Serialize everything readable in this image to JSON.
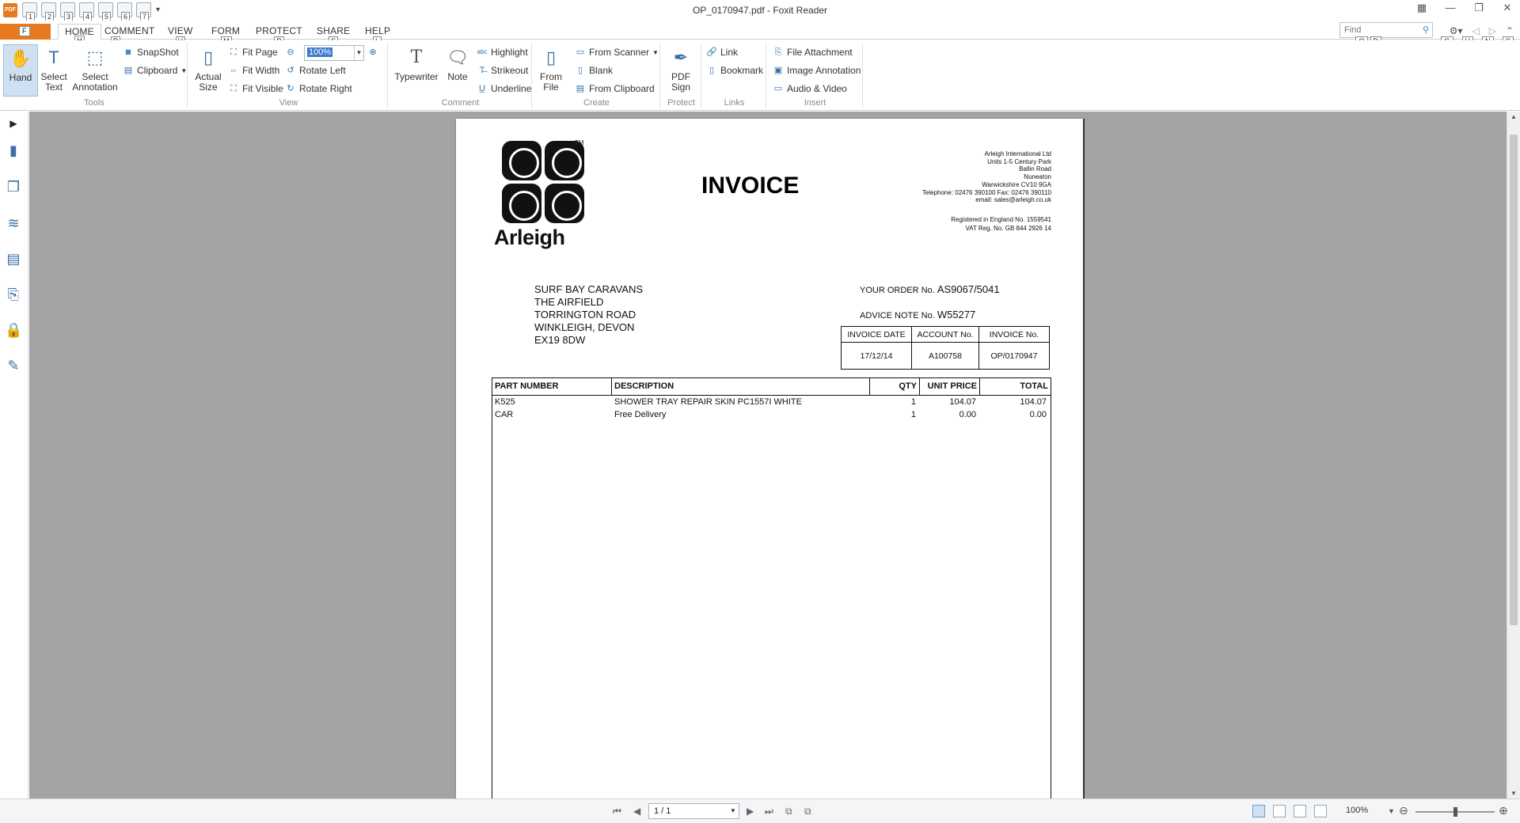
{
  "window": {
    "title": "OP_0170947.pdf - Foxit Reader",
    "app_logo": "PDF"
  },
  "quick_access": {
    "keys": [
      "1",
      "2",
      "3",
      "4",
      "5",
      "6",
      "7"
    ],
    "icons": [
      "open-icon",
      "save-icon",
      "print-icon",
      "email-icon",
      "new-icon",
      "undo-icon",
      "redo-icon"
    ]
  },
  "tabs": {
    "file_key": "F",
    "items": [
      {
        "label": "HOME",
        "key": "H"
      },
      {
        "label": "COMMENT",
        "key": "R"
      },
      {
        "label": "VIEW",
        "key": "V"
      },
      {
        "label": "FORM",
        "key": "M"
      },
      {
        "label": "PROTECT",
        "key": "P"
      },
      {
        "label": "SHARE",
        "key": "S"
      },
      {
        "label": "HELP",
        "key": "L"
      }
    ],
    "find_placeholder": "Find",
    "find_keys": [
      "Q",
      "D"
    ],
    "settings_key": "G",
    "nav_keys": [
      "U",
      "N",
      "C"
    ]
  },
  "ribbon": {
    "tools": {
      "label": "Tools",
      "hand": "Hand",
      "select_text": [
        "Select",
        "Text"
      ],
      "select_annotation": [
        "Select",
        "Annotation"
      ],
      "snapshot": "SnapShot",
      "clipboard": "Clipboard"
    },
    "view": {
      "label": "View",
      "actual_size": [
        "Actual",
        "Size"
      ],
      "fit_page": "Fit Page",
      "fit_width": "Fit Width",
      "fit_visible": "Fit Visible",
      "zoom_value": "100%",
      "rotate_left": "Rotate Left",
      "rotate_right": "Rotate Right"
    },
    "comment": {
      "label": "Comment",
      "typewriter": "Typewriter",
      "note": "Note",
      "highlight": "Highlight",
      "strikeout": "Strikeout",
      "underline": "Underline"
    },
    "create": {
      "label": "Create",
      "from_file": [
        "From",
        "File"
      ],
      "from_scanner": "From Scanner",
      "blank": "Blank",
      "from_clipboard": "From Clipboard"
    },
    "protect": {
      "label": "Protect",
      "pdf_sign": [
        "PDF",
        "Sign"
      ]
    },
    "links": {
      "label": "Links",
      "link": "Link",
      "bookmark": "Bookmark"
    },
    "insert": {
      "label": "Insert",
      "file_attachment": "File Attachment",
      "image_annotation": "Image Annotation",
      "audio_video": "Audio & Video"
    }
  },
  "document": {
    "logo_text": "Arleigh",
    "logo_tm": "TM",
    "title": "INVOICE",
    "company_lines": [
      "Arleigh International Ltd",
      "Units 1-5 Century Park",
      "Ballin Road",
      "Nuneaton",
      "Warwickshire CV10 9GA",
      "Telephone: 02476 390100 Fax: 02476 390110",
      "email: sales@arleigh.co.uk"
    ],
    "reg_lines": [
      "Registered in England No. 1559541",
      "VAT Reg. No. GB 844 2926 14"
    ],
    "address_lines": [
      "SURF BAY CARAVANS",
      "THE AIRFIELD",
      "TORRINGTON ROAD",
      "WINKLEIGH, DEVON",
      "EX19 8DW"
    ],
    "your_order_label": "YOUR ORDER No.",
    "your_order_value": "AS9067/5041",
    "advice_note_label": "ADVICE NOTE No.",
    "advice_note_value": "W55277",
    "info_headers": [
      "INVOICE DATE",
      "ACCOUNT No.",
      "INVOICE No."
    ],
    "info_values": [
      "17/12/14",
      "A100758",
      "OP/0170947"
    ],
    "line_headers": [
      "PART NUMBER",
      "DESCRIPTION",
      "QTY",
      "UNIT PRICE",
      "TOTAL"
    ],
    "lines": [
      [
        "K525",
        "SHOWER TRAY REPAIR SKIN PC1557I WHITE",
        "1",
        "104.07",
        "104.07"
      ],
      [
        "CAR",
        "Free Delivery",
        "1",
        "0.00",
        "0.00"
      ]
    ]
  },
  "status": {
    "page_display": "1 / 1",
    "zoom": "100%"
  }
}
